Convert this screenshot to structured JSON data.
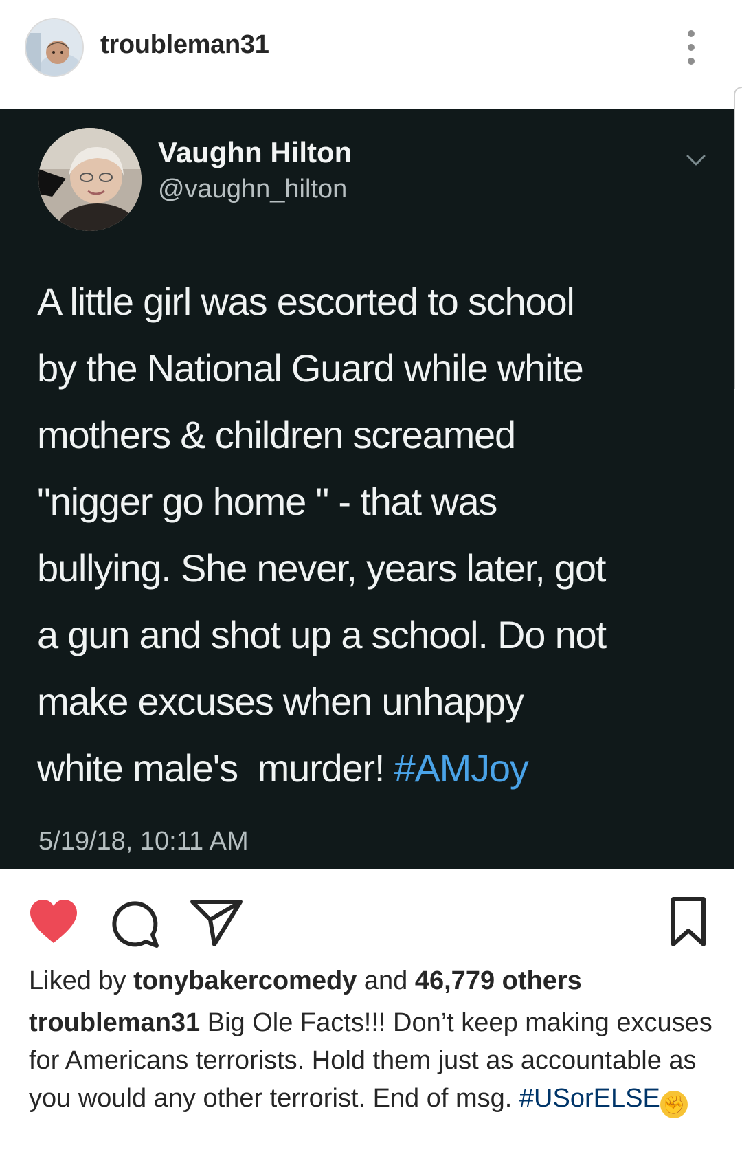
{
  "post": {
    "username": "troubleman31",
    "more_icon": "more-vertical-icon"
  },
  "tweet": {
    "name": "Vaughn Hilton",
    "handle": "@vaughn_hilton",
    "text_lines": [
      "A little girl was escorted to school",
      "by the National Guard while white",
      "mothers & children screamed",
      "\"nigger go home \" - that was",
      "bullying. She never, years later, got",
      "a gun and shot up a school. Do not",
      "make excuses when unhappy"
    ],
    "last_line_text": "white male's  murder! ",
    "hashtag": "#AMJoy",
    "timestamp": "5/19/18, 10:11 AM",
    "hashtag_color": "#4aa3e8",
    "background_color": "#10191a"
  },
  "actions": {
    "like_icon": "heart-icon",
    "liked": true,
    "like_color": "#ed4956",
    "comment_icon": "comment-icon",
    "share_icon": "share-icon",
    "save_icon": "bookmark-icon"
  },
  "likes": {
    "prefix": "Liked by ",
    "liker": "tonybakercomedy",
    "middle": " and ",
    "others": "46,779 others"
  },
  "caption": {
    "username": "troubleman31",
    "text": " Big Ole Facts!!! Don’t keep making excuses for Americans terrorists. Hold them just as accountable as you would any other terrorist. End of msg. ",
    "hashtag": "#USorELSE",
    "emoji": "✊",
    "hashtag_color": "#003569"
  }
}
